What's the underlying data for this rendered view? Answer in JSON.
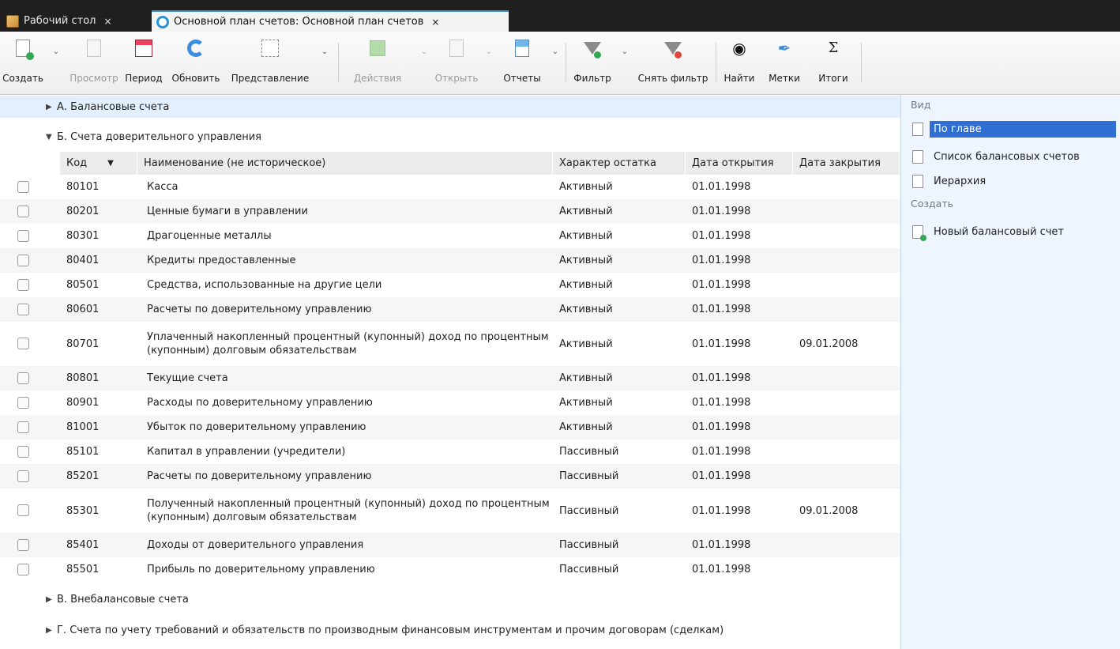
{
  "tabs": [
    {
      "label": "Рабочий стол",
      "close": "×",
      "icon": "desktop-icon"
    },
    {
      "label": "Основной план счетов: Основной план счетов",
      "close": "×",
      "icon": "chart-of-accounts-icon"
    }
  ],
  "toolbar": {
    "create": "Создать",
    "view": "Просмотр",
    "period": "Период",
    "refresh": "Обновить",
    "presentation": "Представление",
    "actions": "Действия",
    "open": "Открыть",
    "reports": "Отчеты",
    "filter": "Фильтр",
    "clear_filter": "Снять фильтр",
    "find": "Найти",
    "tags": "Метки",
    "totals": "Итоги"
  },
  "groups": {
    "a": "А. Балансовые счета",
    "b": "Б. Счета доверительного управления",
    "v": "В. Внебалансовые счета",
    "g": "Г. Счета по учету требований и обязательств по производным финансовым инструментам и прочим договорам (сделкам)"
  },
  "columns": {
    "code": "Код",
    "name": "Наименование (не историческое)",
    "balance_type": "Характер остатка",
    "open_date": "Дата открытия",
    "close_date": "Дата закрытия"
  },
  "rows": [
    {
      "code": "80101",
      "name": "Касса",
      "balance_type": "Активный",
      "open_date": "01.01.1998",
      "close_date": ""
    },
    {
      "code": "80201",
      "name": "Ценные бумаги в управлении",
      "balance_type": "Активный",
      "open_date": "01.01.1998",
      "close_date": ""
    },
    {
      "code": "80301",
      "name": "Драгоценные металлы",
      "balance_type": "Активный",
      "open_date": "01.01.1998",
      "close_date": ""
    },
    {
      "code": "80401",
      "name": "Кредиты предоставленные",
      "balance_type": "Активный",
      "open_date": "01.01.1998",
      "close_date": ""
    },
    {
      "code": "80501",
      "name": "Средства, использованные на другие цели",
      "balance_type": "Активный",
      "open_date": "01.01.1998",
      "close_date": ""
    },
    {
      "code": "80601",
      "name": "Расчеты по доверительному управлению",
      "balance_type": "Активный",
      "open_date": "01.01.1998",
      "close_date": ""
    },
    {
      "code": "80701",
      "name": "Уплаченный накопленный процентный (купонный) доход по процентным (купонным) долговым обязательствам",
      "balance_type": "Активный",
      "open_date": "01.01.1998",
      "close_date": "09.01.2008"
    },
    {
      "code": "80801",
      "name": "Текущие счета",
      "balance_type": "Активный",
      "open_date": "01.01.1998",
      "close_date": ""
    },
    {
      "code": "80901",
      "name": "Расходы по доверительному управлению",
      "balance_type": "Активный",
      "open_date": "01.01.1998",
      "close_date": ""
    },
    {
      "code": "81001",
      "name": "Убыток по доверительному управлению",
      "balance_type": "Активный",
      "open_date": "01.01.1998",
      "close_date": ""
    },
    {
      "code": "85101",
      "name": "Капитал в управлении (учредители)",
      "balance_type": "Пассивный",
      "open_date": "01.01.1998",
      "close_date": ""
    },
    {
      "code": "85201",
      "name": "Расчеты по доверительному управлению",
      "balance_type": "Пассивный",
      "open_date": "01.01.1998",
      "close_date": ""
    },
    {
      "code": "85301",
      "name": "Полученный накопленный процентный (купонный) доход по процентным (купонным) долговым обязательствам",
      "balance_type": "Пассивный",
      "open_date": "01.01.1998",
      "close_date": "09.01.2008"
    },
    {
      "code": "85401",
      "name": "Доходы от доверительного управления",
      "balance_type": "Пассивный",
      "open_date": "01.01.1998",
      "close_date": ""
    },
    {
      "code": "85501",
      "name": "Прибыль по доверительному управлению",
      "balance_type": "Пассивный",
      "open_date": "01.01.1998",
      "close_date": ""
    }
  ],
  "panel": {
    "view_title": "Вид",
    "by_chapter": "По главе",
    "balance_list": "Список балансовых счетов",
    "hierarchy": "Иерархия",
    "create_title": "Создать",
    "new_balance_account": "Новый балансовый счет"
  },
  "colors": {
    "accent": "#2f6fd3",
    "tabbar": "#1f1f1f",
    "selected_group": "#e2efff",
    "panel": "#eef5fe"
  }
}
